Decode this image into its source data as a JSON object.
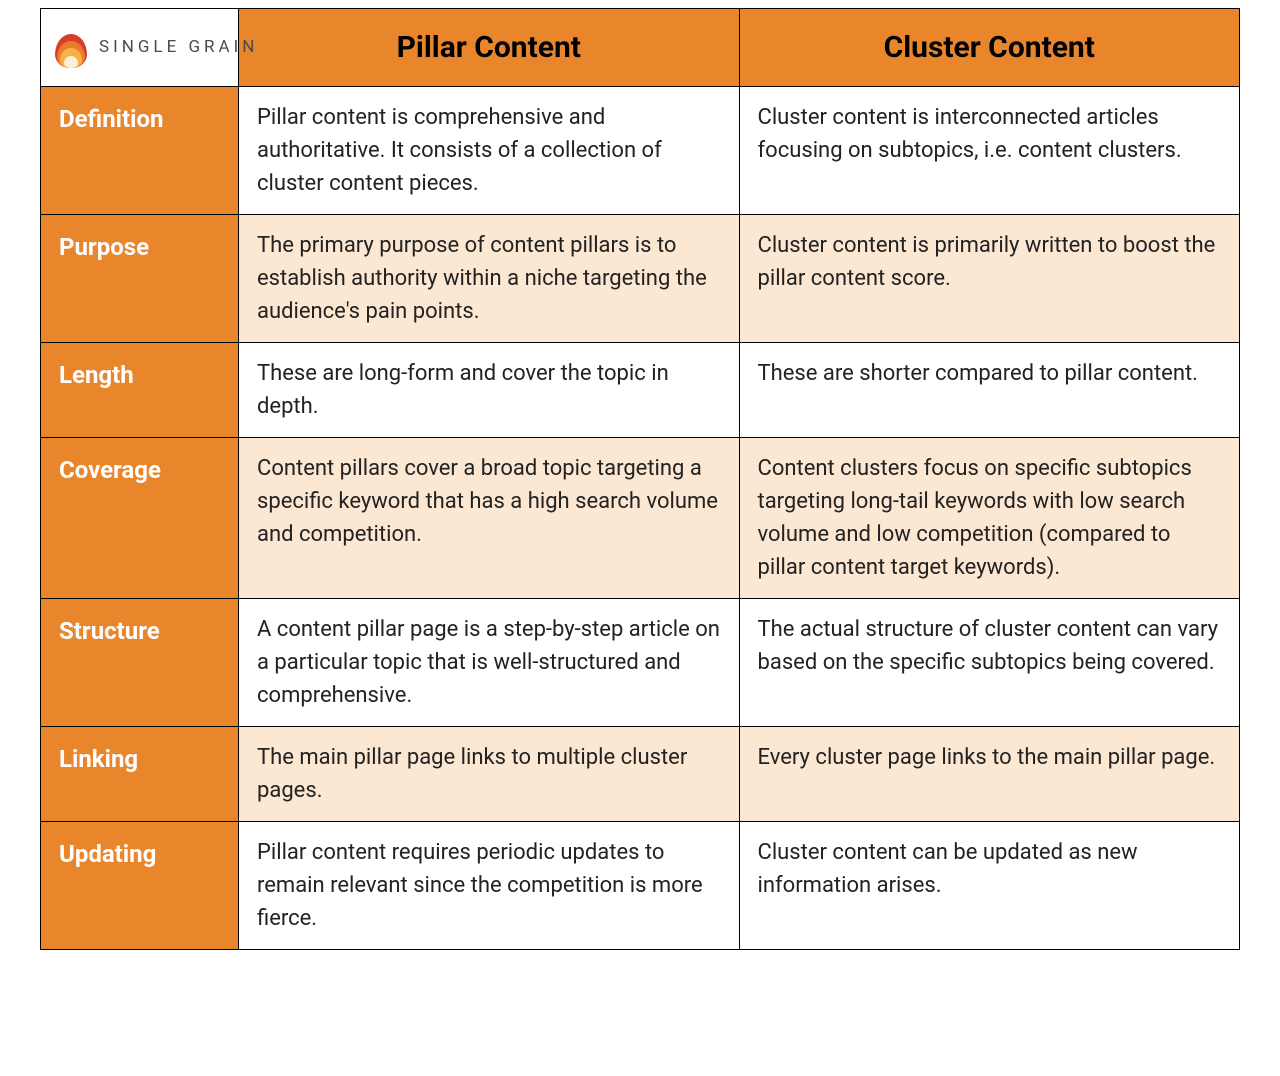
{
  "brand_name": "SINGLE GRAIN",
  "columns": [
    "Pillar Content",
    "Cluster Content"
  ],
  "rows": [
    {
      "label": "Definition",
      "pillar": "Pillar content is comprehensive and authoritative. It consists of a collection of cluster content pieces.",
      "cluster": "Cluster content is interconnected articles focusing on subtopics, i.e. content clusters."
    },
    {
      "label": "Purpose",
      "pillar": "The primary purpose of content pillars is to establish authority within a niche targeting the audience's pain points.",
      "cluster": "Cluster content is primarily written to boost the pillar content score."
    },
    {
      "label": "Length",
      "pillar": "These are long-form and cover the topic in depth.",
      "cluster": "These are shorter compared to pillar content."
    },
    {
      "label": "Coverage",
      "pillar": "Content pillars cover a broad topic targeting a specific keyword that has a high search volume and competition.",
      "cluster": "Content clusters focus on specific subtopics targeting long-tail keywords with low search volume and low competition (compared to pillar content target keywords)."
    },
    {
      "label": "Structure",
      "pillar": "A content pillar page is a step-by-step article on a particular topic that is well-structured and comprehensive.",
      "cluster": "The actual structure of cluster content can vary based on the specific subtopics being covered."
    },
    {
      "label": "Linking",
      "pillar": "The main pillar page links to multiple cluster pages.",
      "cluster": "Every cluster page links to the main pillar page."
    },
    {
      "label": "Updating",
      "pillar": "Pillar content requires periodic updates to remain relevant since the competition is more fierce.",
      "cluster": "Cluster content can be updated as new information arises."
    }
  ],
  "colors": {
    "header_bg": "#e9862c",
    "alt_row_bg": "#fbe7d2",
    "border": "#000000"
  }
}
